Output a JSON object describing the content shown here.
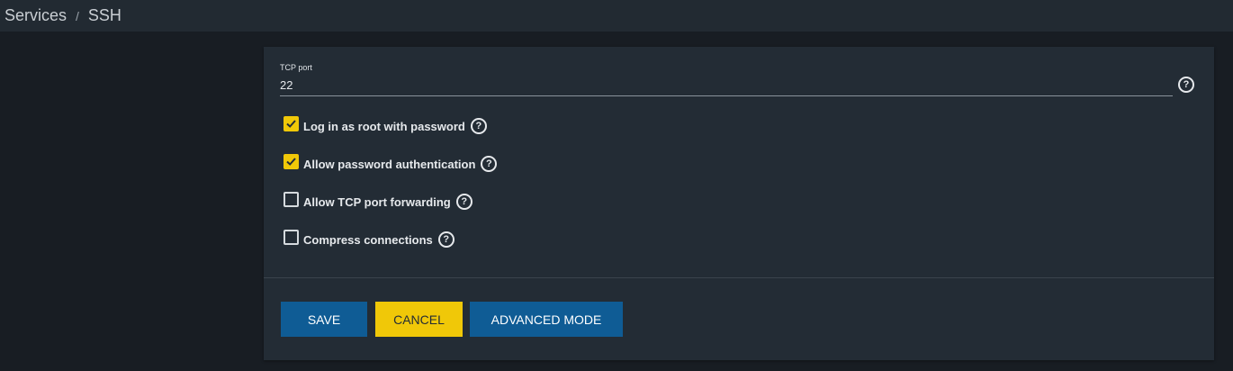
{
  "breadcrumb": {
    "parent": "Services",
    "separator": "/",
    "current": "SSH"
  },
  "form": {
    "tcp_port": {
      "label": "TCP port",
      "value": "22",
      "help_icon": "help-circle-icon"
    },
    "options": [
      {
        "label": "Log in as root with password",
        "checked": true
      },
      {
        "label": "Allow password authentication",
        "checked": true
      },
      {
        "label": "Allow TCP port forwarding",
        "checked": false
      },
      {
        "label": "Compress connections",
        "checked": false
      }
    ]
  },
  "actions": {
    "save_label": "SAVE",
    "cancel_label": "CANCEL",
    "advanced_label": "ADVANCED MODE"
  },
  "colors": {
    "accent_yellow": "#f0c808",
    "primary_blue": "#0f5c95",
    "card_bg": "#232c35",
    "page_bg": "#181d23"
  }
}
